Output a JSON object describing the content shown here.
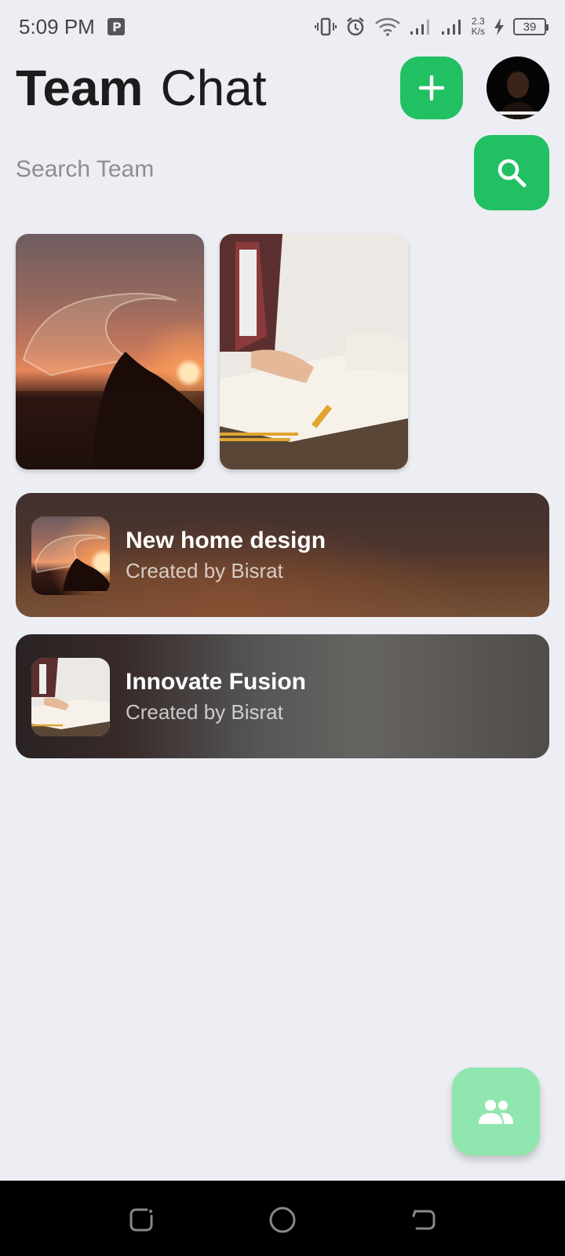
{
  "status_bar": {
    "time": "5:09 PM",
    "net_speed_value": "2.3",
    "net_speed_unit": "K/s",
    "battery": "39",
    "icons": [
      "parking-icon",
      "vibrate-icon",
      "alarm-icon",
      "wifi-icon",
      "signal-icon",
      "signal-icon",
      "charging-icon",
      "battery-icon"
    ]
  },
  "header": {
    "title_bold": "Team",
    "title_light": "Chat",
    "add_icon": "plus-icon",
    "avatar": "user-avatar"
  },
  "search": {
    "placeholder": "Search Team",
    "value": "",
    "button_icon": "search-icon"
  },
  "featured": [
    {
      "image": "ocean-wave-sunset"
    },
    {
      "image": "person-drawing-blueprint"
    }
  ],
  "teams": [
    {
      "name": "New home design",
      "subtitle": "Created by Bisrat",
      "image": "ocean-wave-sunset"
    },
    {
      "name": "Innovate Fusion",
      "subtitle": "Created by Bisrat",
      "image": "person-drawing-blueprint"
    }
  ],
  "fab": {
    "icon": "group-icon"
  },
  "nav": {
    "icons": [
      "recent-apps-icon",
      "home-icon",
      "back-icon"
    ]
  },
  "colors": {
    "background": "#eceef3",
    "accent": "#21c063",
    "fab": "#8fe6ae",
    "title": "#1c1c1c",
    "placeholder": "#8e8e8e"
  }
}
